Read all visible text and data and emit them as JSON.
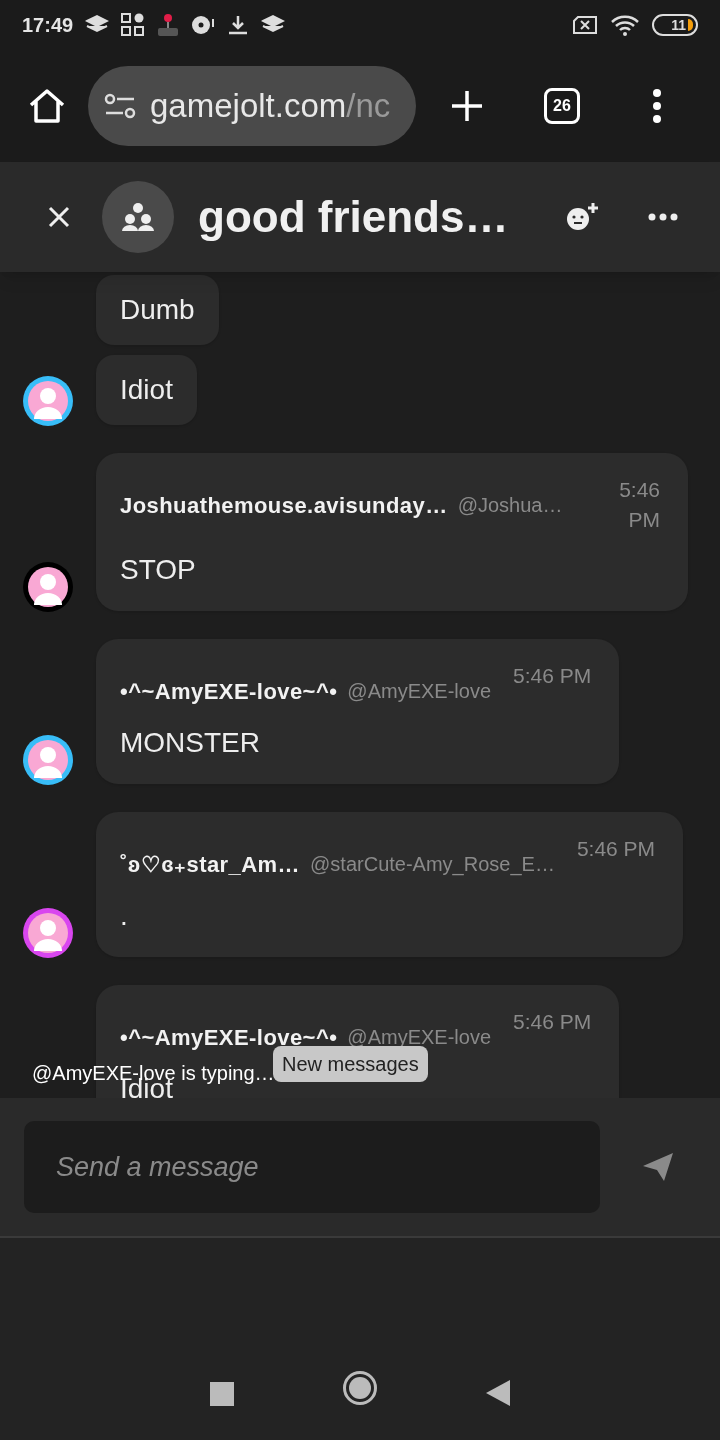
{
  "status_bar": {
    "time": "17:49",
    "battery": "11"
  },
  "browser": {
    "url_host": "gamejolt.com",
    "url_path": "/nc",
    "tab_count": "26"
  },
  "chat": {
    "title": "good friends…",
    "messages": [
      {
        "kind": "plain",
        "avatar": false,
        "text": "Dumb"
      },
      {
        "kind": "plain",
        "avatar": true,
        "color": "#38bdf8",
        "text": "Idiot"
      },
      {
        "kind": "full",
        "avatar": true,
        "color": "#000000",
        "name": "Joshuathemouse.avisunday…",
        "handle": "@Joshua…",
        "time": "5:46 PM",
        "text": "STOP"
      },
      {
        "kind": "full",
        "avatar": true,
        "color": "#38bdf8",
        "name": "•^~AmyEXE-love~^•",
        "handle": "@AmyEXE-love",
        "time": "5:46 PM",
        "text": "MONSTER"
      },
      {
        "kind": "full",
        "avatar": true,
        "color": "#d946ef",
        "name": "˚ʚ♡ɞ₊star_Am…",
        "handle": "@starCute-Amy_Rose_E…",
        "time": "5:46 PM",
        "text": "."
      },
      {
        "kind": "full",
        "avatar": false,
        "name": "•^~AmyEXE-love~^•",
        "handle": "@AmyEXE-love",
        "time": "5:46 PM",
        "text": "Idiot"
      }
    ],
    "typing": "@AmyEXE-love is typing…",
    "new_messages": "New messages",
    "input": {
      "placeholder": "Send a message"
    }
  }
}
